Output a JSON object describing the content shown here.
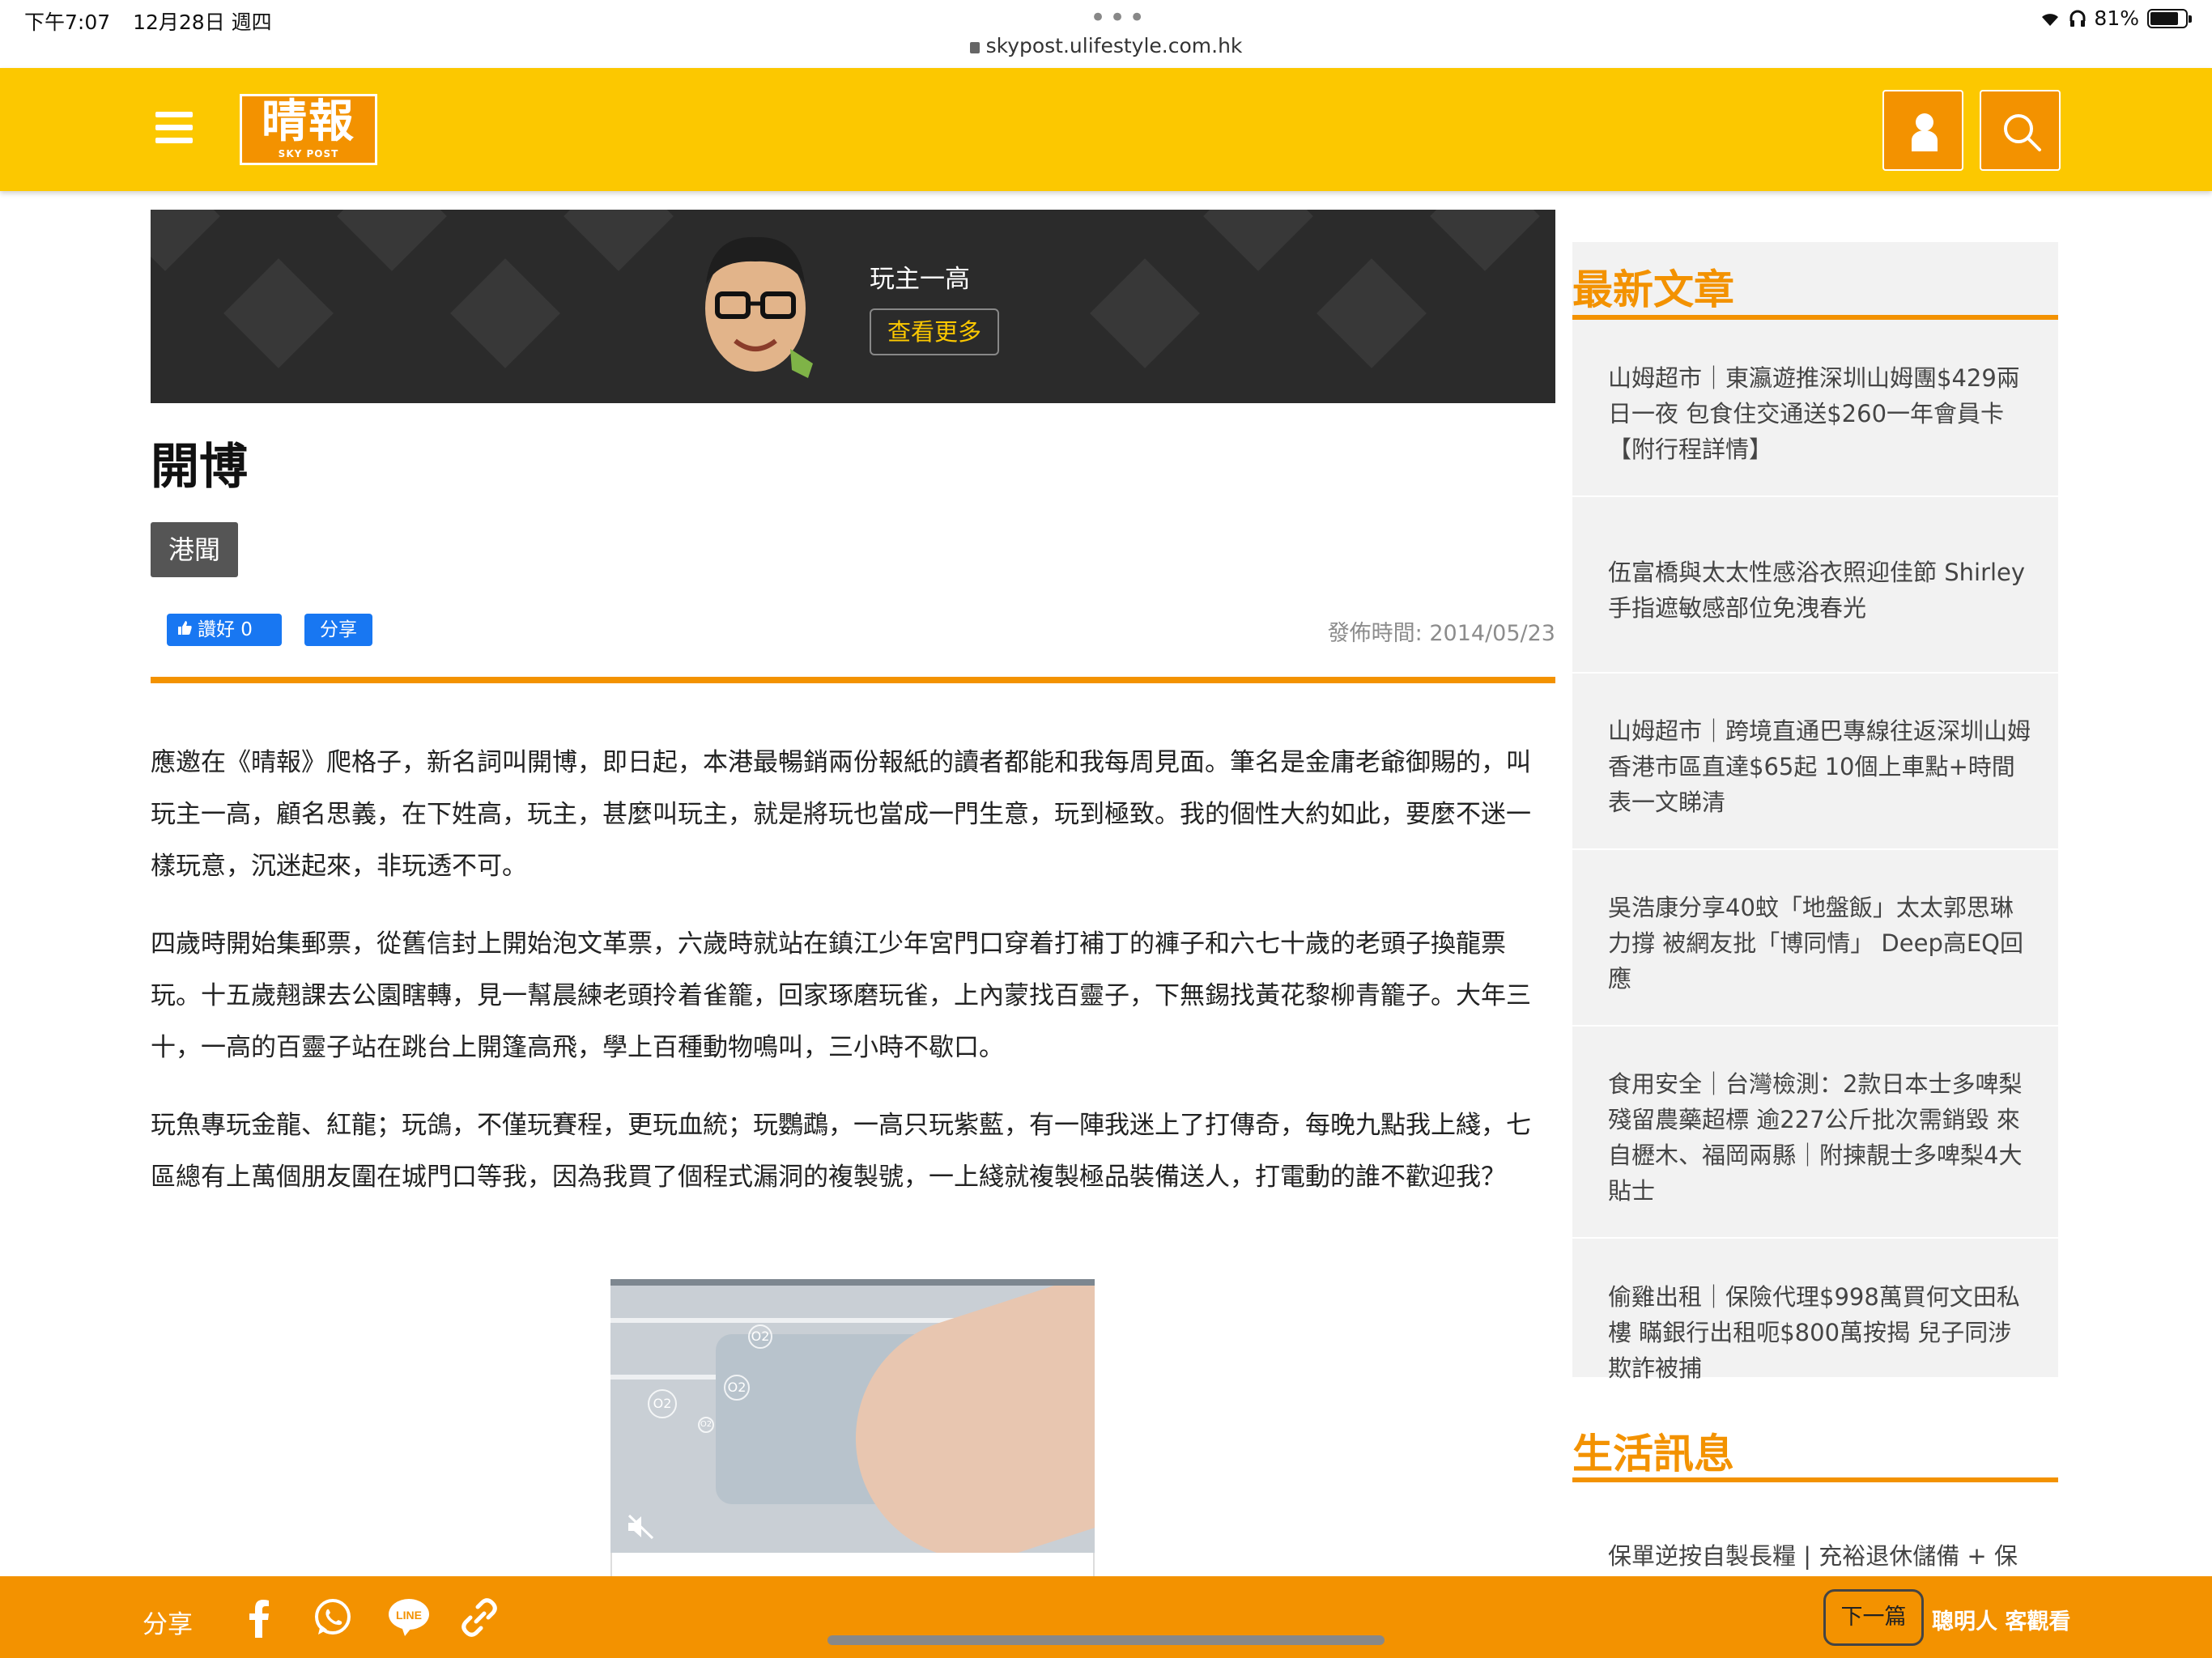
{
  "status_bar": {
    "time": "下午7:07",
    "date": "12月28日 週四",
    "dots": "•••",
    "url": "skypost.ulifestyle.com.hk",
    "battery": "81%"
  },
  "header": {
    "logo_text": "晴報",
    "logo_sub": "SKY POST",
    "brand_color": "#fcc800",
    "accent_color": "#f39200"
  },
  "author": {
    "name": "玩主一高",
    "more_label": "查看更多"
  },
  "article": {
    "title": "開博",
    "tag": "港聞",
    "like_label": "讚好 0",
    "share_label": "分享",
    "publish_time": "發佈時間: 2014/05/23",
    "paragraphs": [
      "應邀在《晴報》爬格子，新名詞叫開博，即日起，本港最暢銷兩份報紙的讀者都能和我每周見面。筆名是金庸老爺御賜的，叫玩主一高，顧名思義，在下姓高，玩主，甚麼叫玩主，就是將玩也當成一門生意，玩到極致。我的個性大約如此，要麼不迷一樣玩意，沉迷起來，非玩透不可。",
      "四歲時開始集郵票，從舊信封上開始泡文革票，六歲時就站在鎮江少年宮門口穿着打補丁的褲子和六七十歲的老頭子換龍票玩。十五歲翹課去公園瞎轉，見一幫晨練老頭拎着雀籠，回家琢磨玩雀，上內蒙找百靈子，下無錫找黃花黎柳青籠子。大年三十，一高的百靈子站在跳台上開篷高飛，學上百種動物鳴叫，三小時不歇口。",
      "玩魚專玩金龍、紅龍；玩鴿，不僅玩賽程，更玩血統；玩鸚鵡，一高只玩紫藍，有一陣我迷上了打傳奇，每晚九點我上綫，七區總有上萬個朋友圍在城門口等我，因為我買了個程式漏洞的複製號，一上綫就複製極品裝備送人，打電動的誰不歡迎我？"
    ]
  },
  "sidebar": {
    "latest_title": "最新文章",
    "latest": [
      "山姆超市｜東瀛遊推深圳山姆團$429兩日一夜 包食住交通送$260一年會員卡【附行程詳情】",
      "伍富橋與太太性感浴衣照迎佳節 Shirley手指遮敏感部位免洩春光",
      "山姆超市｜跨境直通巴專線往返深圳山姆 香港市區直達$65起 10個上車點+時間表一文睇清",
      "吳浩康分享40蚊「地盤飯」太太郭思琳力撐 被網友批「博同情」 Deep高EQ回應",
      "食用安全｜台灣檢測：2款日本士多啤梨殘留農藥超標 逾227公斤批次需銷毀 來自櫪木、福岡兩縣｜附揀靚士多啤梨4大貼士",
      "偷雞出租｜保險代理$998萬買何文田私樓 瞞銀行出租呃$800萬按揭 兒子同涉欺詐被捕"
    ],
    "life_title": "生活訊息",
    "life": [
      "保單逆按自製長糧 | 充裕退休儲備 + 保"
    ]
  },
  "video": {
    "bubbles": [
      "O2",
      "O2",
      "O2",
      "O2"
    ]
  },
  "bottom_bar": {
    "share_label": "分享",
    "line_label": "LINE",
    "next_label": "下一篇",
    "next_title": "聰明人 客觀看"
  }
}
